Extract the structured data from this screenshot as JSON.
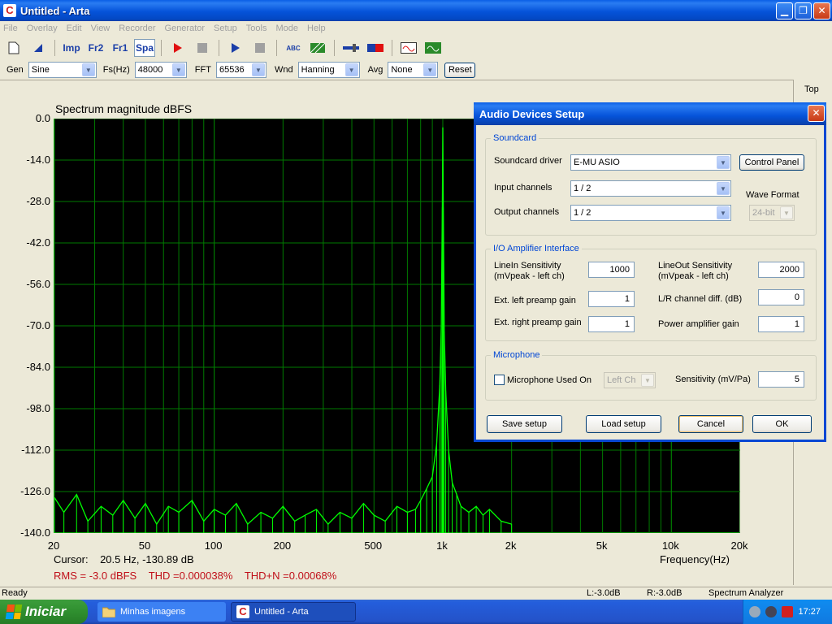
{
  "window": {
    "title": "Untitled - Arta",
    "app_icon_letter": "C",
    "min_glyph": "▁",
    "restore_glyph": "❐",
    "close_glyph": "✕"
  },
  "menu": [
    "File",
    "Overlay",
    "Edit",
    "View",
    "Recorder",
    "Generator",
    "Setup",
    "Tools",
    "Mode",
    "Help"
  ],
  "toolbar": {
    "imp": "Imp",
    "fr2": "Fr2",
    "fr1": "Fr1",
    "spa": "Spa",
    "abc": "ABC",
    "record_color": "#e01010",
    "play_color": "#1a3ea8"
  },
  "settings": {
    "gen_label": "Gen",
    "gen_value": "Sine",
    "fs_label": "Fs(Hz)",
    "fs_value": "48000",
    "fft_label": "FFT",
    "fft_value": "65536",
    "wnd_label": "Wnd",
    "wnd_value": "Hanning",
    "avg_label": "Avg",
    "avg_value": "None",
    "reset_label": "Reset"
  },
  "side_panel": {
    "top_label": "Top"
  },
  "chart_data": {
    "type": "line",
    "title": "Spectrum magnitude dBFS",
    "xlabel": "Frequency(Hz)",
    "ylabel": "",
    "x_scale": "log",
    "xlim": [
      20,
      20000
    ],
    "ylim": [
      -140,
      0
    ],
    "yticks": [
      "0.0",
      "-14.0",
      "-28.0",
      "-42.0",
      "-56.0",
      "-70.0",
      "-84.0",
      "-98.0",
      "-112.0",
      "-126.0",
      "-140.0"
    ],
    "xticks": [
      {
        "value": 20,
        "label": "20"
      },
      {
        "value": 50,
        "label": "50"
      },
      {
        "value": 100,
        "label": "100"
      },
      {
        "value": 200,
        "label": "200"
      },
      {
        "value": 500,
        "label": "500"
      },
      {
        "value": 1000,
        "label": "1k"
      },
      {
        "value": 2000,
        "label": "2k"
      },
      {
        "value": 5000,
        "label": "5k"
      },
      {
        "value": 10000,
        "label": "10k"
      },
      {
        "value": 20000,
        "label": "20k"
      }
    ],
    "grid": true,
    "series": [
      {
        "color": "#00ff00",
        "x": [
          20,
          22,
          25,
          28,
          32,
          36,
          40,
          45,
          50,
          56,
          63,
          70,
          80,
          90,
          100,
          112,
          125,
          140,
          160,
          180,
          200,
          225,
          250,
          280,
          315,
          355,
          400,
          450,
          500,
          560,
          630,
          700,
          760,
          800,
          850,
          900,
          940,
          970,
          985,
          995,
          1000,
          1005,
          1015,
          1030,
          1060,
          1100,
          1150,
          1200,
          1300,
          1400,
          1500,
          1600,
          1800,
          2000
        ],
        "y": [
          -128,
          -133,
          -127,
          -136,
          -131,
          -134,
          -129,
          -135,
          -130,
          -137,
          -131,
          -133,
          -129,
          -136,
          -132,
          -134,
          -130,
          -137,
          -133,
          -135,
          -131,
          -136,
          -134,
          -132,
          -137,
          -133,
          -135,
          -130,
          -134,
          -136,
          -131,
          -133,
          -132,
          -129,
          -125,
          -121,
          -110,
          -90,
          -70,
          -30,
          -3,
          -30,
          -72,
          -92,
          -112,
          -123,
          -127,
          -131,
          -133,
          -131,
          -134,
          -132,
          -136,
          -137
        ]
      }
    ]
  },
  "cursor": {
    "label": "Cursor:",
    "value": "20.5 Hz, -130.89 dB"
  },
  "measurements": {
    "rms": "RMS =   -3.0 dBFS",
    "thd": "THD =0.000038%",
    "thdn": "THD+N =0.00068%"
  },
  "status": {
    "ready": "Ready",
    "left": "L:-3.0dB",
    "right": "R:-3.0dB",
    "mode": "Spectrum Analyzer"
  },
  "dialog": {
    "title": "Audio Devices Setup",
    "soundcard": {
      "title": "Soundcard",
      "driver_label": "Soundcard driver",
      "driver_value": "E-MU ASIO",
      "control_panel": "Control Panel",
      "input_label": "Input channels",
      "input_value": "1 / 2",
      "output_label": "Output channels",
      "output_value": "1 / 2",
      "wave_format_label": "Wave Format",
      "wave_format_value": "24-bit"
    },
    "io": {
      "title": "I/O Amplifier Interface",
      "linein_label_1": "LineIn Sensitivity",
      "linein_label_2": "(mVpeak - left ch)",
      "linein_value": "1000",
      "lineout_label_1": "LineOut Sensitivity",
      "lineout_label_2": "(mVpeak - left ch)",
      "lineout_value": "2000",
      "ext_left_label": "Ext. left preamp gain",
      "ext_left_value": "1",
      "lr_diff_label": "L/R channel diff. (dB)",
      "lr_diff_value": "0",
      "ext_right_label": "Ext. right preamp gain",
      "ext_right_value": "1",
      "power_label": "Power amplifier gain",
      "power_value": "1"
    },
    "mic": {
      "title": "Microphone",
      "used_label": "Microphone Used On",
      "used_checked": false,
      "channel_value": "Left Ch",
      "sens_label": "Sensitivity (mV/Pa)",
      "sens_value": "5"
    },
    "buttons": {
      "save": "Save setup",
      "load": "Load setup",
      "cancel": "Cancel",
      "ok": "OK"
    }
  },
  "taskbar": {
    "start": "Iniciar",
    "tasks": [
      "Minhas imagens",
      "Untitled - Arta"
    ],
    "clock": "17:27"
  }
}
